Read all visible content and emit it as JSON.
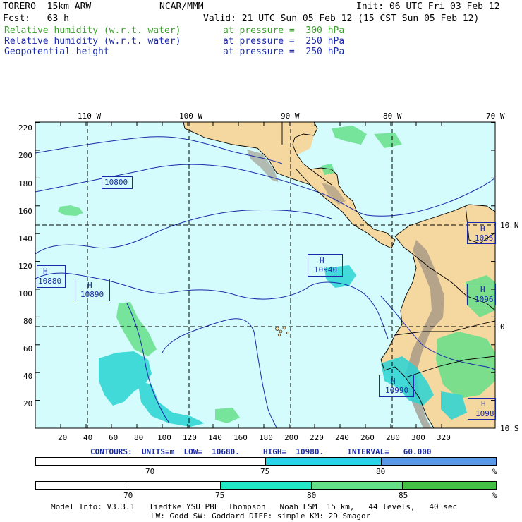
{
  "header": {
    "model": "TORERO  15km ARW",
    "org": "NCAR/MMM",
    "init": "Init: 06 UTC Fri 03 Feb 12",
    "fcst": "Fcst:   63 h",
    "valid": "Valid: 21 UTC Sun 05 Feb 12 (15 CST Sun 05 Feb 12)",
    "fields": [
      {
        "name": "Relative humidity (w.r.t. water)",
        "level": "at pressure =  300 hPa",
        "color": "#3a9d2c"
      },
      {
        "name": "Relative humidity (w.r.t. water)",
        "level": "at pressure =  250 hPa",
        "color": "#1a2aa8"
      },
      {
        "name": "Geopotential height",
        "level": "at pressure =  250 hPa",
        "color": "#1a2aa8"
      }
    ]
  },
  "map": {
    "lon_labels": [
      "110 W",
      "100 W",
      "90 W",
      "80 W",
      "70 W"
    ],
    "lat_labels": [
      "10 N",
      "0",
      "10 S"
    ],
    "y_ticks": [
      "220",
      "200",
      "180",
      "160",
      "140",
      "120",
      "100",
      "80",
      "60",
      "40",
      "20"
    ],
    "x_ticks": [
      "20",
      "40",
      "60",
      "80",
      "100",
      "120",
      "140",
      "160",
      "180",
      "200",
      "220",
      "240",
      "260",
      "280",
      "300",
      "320"
    ],
    "highs": [
      {
        "label": "H",
        "value": "10880"
      },
      {
        "label": "H",
        "value": "10890"
      },
      {
        "label": "H",
        "value": "10940"
      },
      {
        "label": "H",
        "value": "1095"
      },
      {
        "label": "H",
        "value": "1096"
      },
      {
        "label": "H",
        "value": "10990"
      },
      {
        "label": "H",
        "value": "1098"
      }
    ],
    "contour_labels": [
      "10800"
    ],
    "colors": {
      "ocean": "#d4fcfc",
      "land": "#f5d7a0",
      "mountain": "#9a8f80",
      "contour": "#1a2aa8",
      "rh_green": "#66e08a",
      "rh_cyan": "#29d4d4",
      "rh_blue": "#3a8ad8"
    }
  },
  "contours_line": "CONTOURS:  UNITS=m  LOW=  10680.     HIGH=  10980.     INTERVAL=   60.000",
  "colorbar1": {
    "labels": [
      "70",
      "75",
      "80",
      "%"
    ],
    "colors": [
      "#ffffff",
      "#ffffff",
      "#29d4e8",
      "#5a98e8"
    ]
  },
  "colorbar2": {
    "labels": [
      "70",
      "75",
      "80",
      "85",
      "%"
    ],
    "colors": [
      "#ffffff",
      "#ffffff",
      "#22e8c8",
      "#66e088",
      "#44c044"
    ]
  },
  "footer": {
    "line1": "Model Info: V3.3.1   Tiedtke YSU PBL  Thompson   Noah LSM  15 km,   44 levels,   40 sec",
    "line2": "LW: Godd SW: Goddard DIFF: simple KM: 2D Smagor"
  }
}
